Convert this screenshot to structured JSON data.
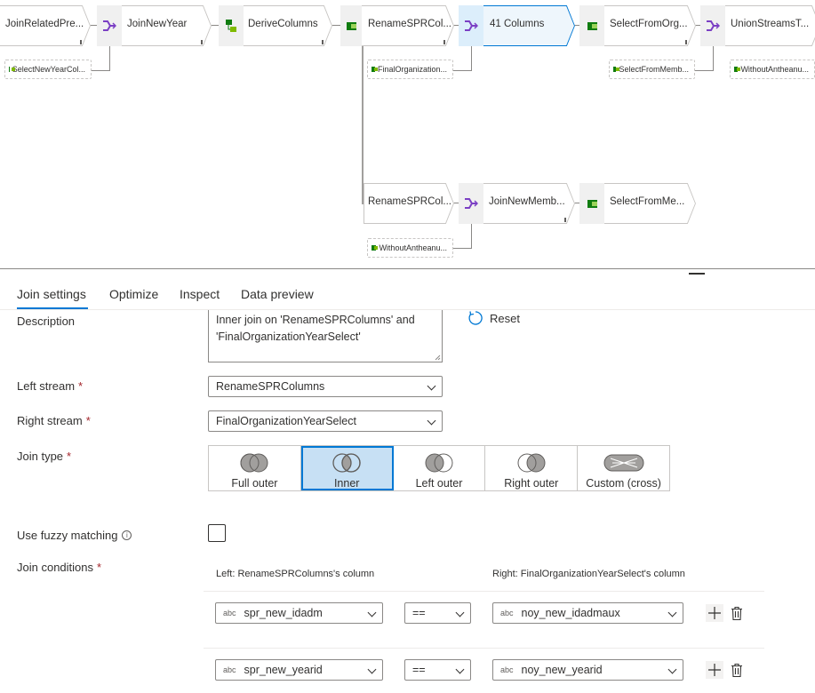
{
  "flow": {
    "top_row": [
      {
        "label": "JoinRelatedPre..."
      },
      {
        "label": "JoinNewYear"
      },
      {
        "label": "DeriveColumns"
      },
      {
        "label": "RenameSPRCol..."
      },
      {
        "label": "41 Columns"
      },
      {
        "label": "SelectFromOrg..."
      },
      {
        "label": "UnionStreamsT..."
      }
    ],
    "bottom_row": [
      {
        "label": "RenameSPRCol..."
      },
      {
        "label": "JoinNewMemb..."
      },
      {
        "label": "SelectFromMe..."
      }
    ],
    "sub_nodes": [
      {
        "label": "SelectNewYearCol..."
      },
      {
        "label": "FinalOrganization..."
      },
      {
        "label": "SelectFromMemb..."
      },
      {
        "label": "WithoutAntheanu..."
      },
      {
        "label": "WithoutAntheanu..."
      }
    ]
  },
  "tabs": [
    {
      "label": "Join settings"
    },
    {
      "label": "Optimize"
    },
    {
      "label": "Inspect"
    },
    {
      "label": "Data preview"
    }
  ],
  "form": {
    "description_label": "Description",
    "description_value": "Inner join on 'RenameSPRColumns' and 'FinalOrganizationYearSelect'",
    "reset_label": "Reset",
    "left_stream_label": "Left stream",
    "left_stream_value": "RenameSPRColumns",
    "right_stream_label": "Right stream",
    "right_stream_value": "FinalOrganizationYearSelect",
    "join_type_label": "Join type",
    "join_types": [
      {
        "label": "Full outer"
      },
      {
        "label": "Inner"
      },
      {
        "label": "Left outer"
      },
      {
        "label": "Right outer"
      },
      {
        "label": "Custom (cross)"
      }
    ],
    "selected_join_type": "Inner",
    "fuzzy_label": "Use fuzzy matching",
    "join_conditions_label": "Join conditions",
    "required_marker": "*",
    "left_column_header": "Left: RenameSPRColumns's column",
    "right_column_header": "Right: FinalOrganizationYearSelect's column",
    "type_tag": "abc",
    "conditions": [
      {
        "left": "spr_new_idadm",
        "op": "==",
        "right": "noy_new_idadmaux"
      },
      {
        "left": "spr_new_yearid",
        "op": "==",
        "right": "noy_new_yearid"
      }
    ]
  },
  "colors": {
    "accent": "#0078d4",
    "selected_bg": "#c7e0f4",
    "join_icon": "#7b3fc4",
    "select_icon": "#107c10",
    "required": "#a4262c"
  }
}
